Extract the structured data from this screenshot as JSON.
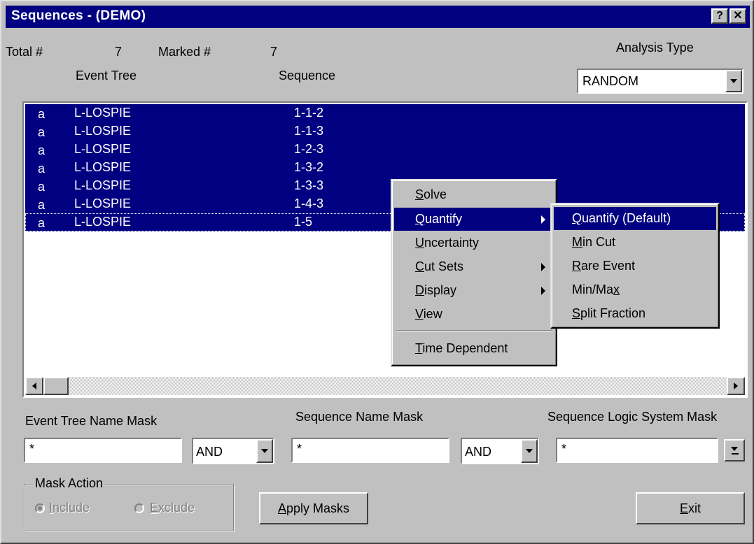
{
  "window": {
    "title": "Sequences  -  (DEMO)",
    "help_button": "?",
    "close_button": "✕"
  },
  "header": {
    "total_label": "Total #",
    "total_value": "7",
    "marked_label": "Marked #",
    "marked_value": "7",
    "col_event_tree": "Event Tree",
    "col_sequence": "Sequence",
    "analysis_type_label": "Analysis Type",
    "analysis_type_value": "RANDOM"
  },
  "rows": [
    {
      "flag": "a",
      "event_tree": "L-LOSPIE",
      "sequence": "1-1-2"
    },
    {
      "flag": "a",
      "event_tree": "L-LOSPIE",
      "sequence": "1-1-3"
    },
    {
      "flag": "a",
      "event_tree": "L-LOSPIE",
      "sequence": "1-2-3"
    },
    {
      "flag": "a",
      "event_tree": "L-LOSPIE",
      "sequence": "1-3-2"
    },
    {
      "flag": "a",
      "event_tree": "L-LOSPIE",
      "sequence": "1-3-3"
    },
    {
      "flag": "a",
      "event_tree": "L-LOSPIE",
      "sequence": "1-4-3"
    },
    {
      "flag": "a",
      "event_tree": "L-LOSPIE",
      "sequence": "1-5"
    }
  ],
  "context_menu": {
    "items": [
      {
        "label": "Solve",
        "key": "S",
        "rest": "olve"
      },
      {
        "label": "Quantify",
        "key": "Q",
        "rest": "uantify"
      },
      {
        "label": "Uncertainty",
        "key": "U",
        "rest": "ncertainty"
      },
      {
        "label": "Cut Sets",
        "key": "C",
        "rest": "ut Sets"
      },
      {
        "label": "Display",
        "key": "D",
        "rest": "isplay"
      },
      {
        "label": "View",
        "key": "V",
        "rest": "iew"
      },
      {
        "label": "Time Dependent",
        "key": "T",
        "rest": "ime Dependent"
      }
    ]
  },
  "submenu": {
    "items": [
      {
        "label": "Quantify (Default)",
        "key": "Q",
        "rest": "uantify (Default)"
      },
      {
        "label": "Min Cut",
        "key": "M",
        "rest": "in Cut"
      },
      {
        "label": "Rare Event",
        "key": "R",
        "rest": "are Event"
      },
      {
        "label": "Min/Max",
        "pre": "Min/Ma",
        "key": "x"
      },
      {
        "label": "Split Fraction",
        "key": "S",
        "rest": "plit Fraction"
      }
    ]
  },
  "masks": {
    "event_tree_label": "Event Tree Name Mask",
    "event_tree_value": "*",
    "op1_value": "AND",
    "sequence_label": "Sequence Name Mask",
    "sequence_value": "*",
    "op2_value": "AND",
    "logic_label": "Sequence Logic System Mask",
    "logic_value": "*"
  },
  "mask_action": {
    "title": "Mask Action",
    "include_key": "I",
    "include_rest": "nclude",
    "exclude_key": "E",
    "exclude_rest": "xclude"
  },
  "buttons": {
    "apply_key": "A",
    "apply_rest": "pply Masks",
    "exit_key": "E",
    "exit_rest": "xit"
  },
  "colors": {
    "face": "#c0c0c0",
    "highlight": "#000080"
  }
}
